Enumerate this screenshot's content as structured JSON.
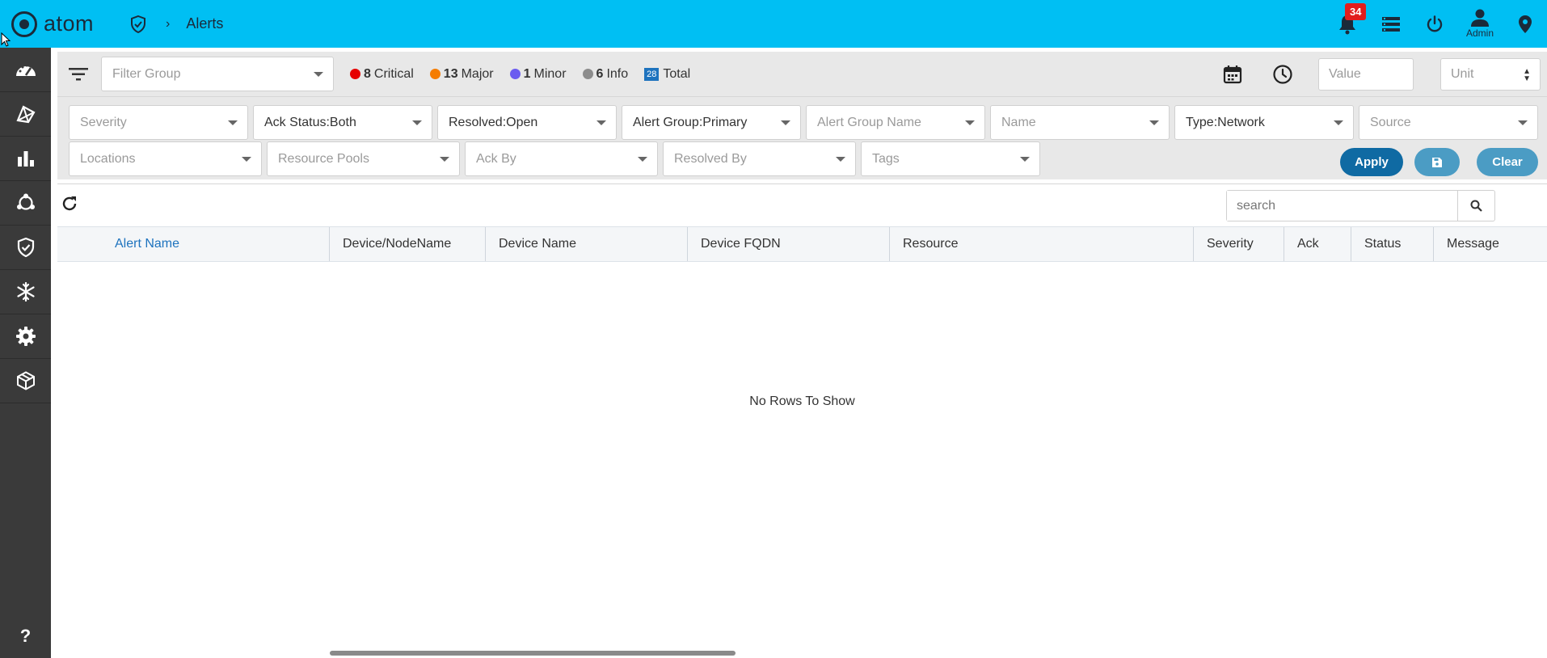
{
  "app": {
    "name": "atom"
  },
  "breadcrumb": {
    "separator": "›",
    "title": "Alerts"
  },
  "header": {
    "notification_count": "34",
    "user_label": "Admin"
  },
  "summary": {
    "filter_group_placeholder": "Filter Group",
    "counts": [
      {
        "count": "8",
        "label": "Critical",
        "color": "#e60000"
      },
      {
        "count": "13",
        "label": "Major",
        "color": "#f57c00"
      },
      {
        "count": "1",
        "label": "Minor",
        "color": "#6b5cf0"
      },
      {
        "count": "6",
        "label": "Info",
        "color": "#8c8c8c"
      }
    ],
    "total": {
      "count": "28",
      "label": "Total"
    },
    "value_placeholder": "Value",
    "unit_placeholder": "Unit"
  },
  "filters": {
    "row1": [
      "Severity",
      "Ack Status:Both",
      "Resolved:Open",
      "Alert Group:Primary",
      "Alert Group Name",
      "Name",
      "Type:Network",
      "Source"
    ],
    "row2": [
      "Locations",
      "Resource Pools",
      "Ack By",
      "Resolved By",
      "Tags"
    ],
    "apply_label": "Apply",
    "clear_label": "Clear"
  },
  "grid": {
    "search_placeholder": "search",
    "columns": [
      "Alert Name",
      "Device/NodeName",
      "Device Name",
      "Device FQDN",
      "Resource",
      "Severity",
      "Ack",
      "Status",
      "Message"
    ],
    "empty_message": "No Rows To Show"
  },
  "sidebar": {
    "items": [
      "dashboard-icon",
      "topology-icon",
      "analytics-icon",
      "network-icon",
      "shield-icon",
      "snowflake-icon",
      "settings-icon",
      "cube-icon"
    ],
    "help_label": "?"
  }
}
